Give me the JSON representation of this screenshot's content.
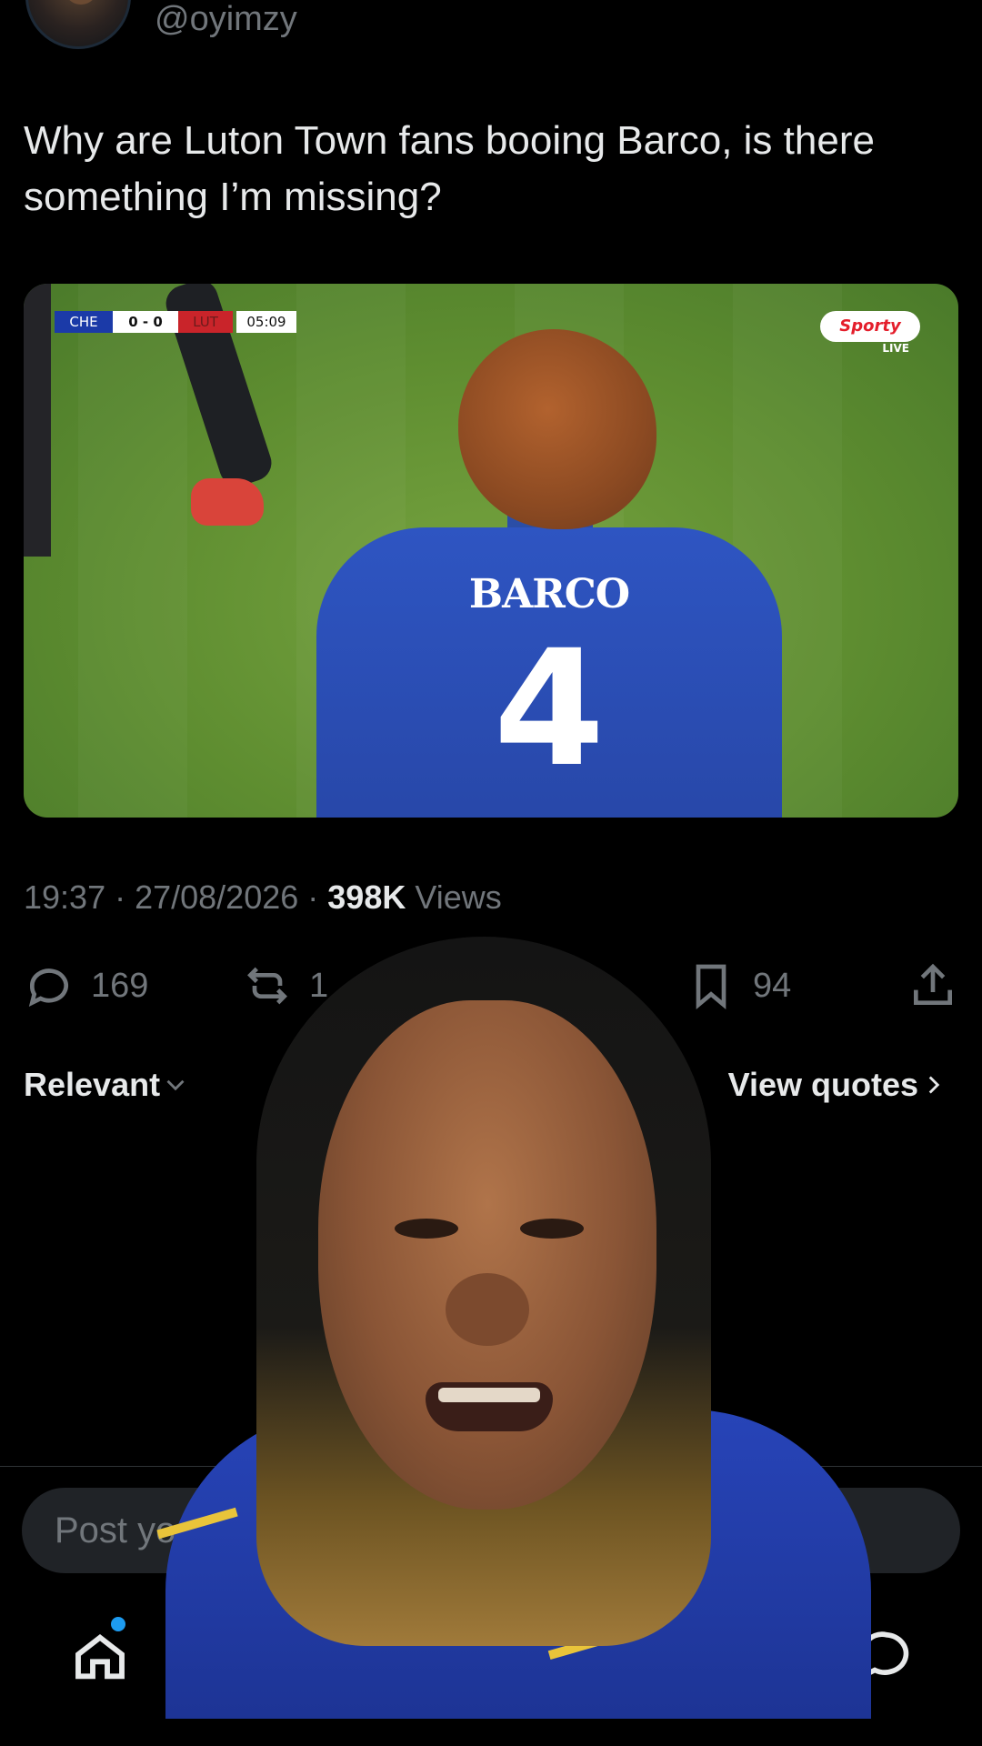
{
  "tweet": {
    "handle": "@oyimzy",
    "text": "Why are Luton Town fans booing Barco, is there something I’m missing?",
    "time": "19:37",
    "date": "27/08/2026",
    "views_count": "398K",
    "views_label": "Views"
  },
  "media": {
    "scoreboard": {
      "home": "CHE",
      "score": "0 - 0",
      "away": "LUT",
      "clock": "05:09"
    },
    "broadcaster": "Sporty",
    "broadcaster_sub": "LIVE",
    "shirt_name": "BARCO",
    "shirt_number": "4"
  },
  "actions": {
    "replies": "169",
    "reposts": "1",
    "bookmarks": "94"
  },
  "sort": {
    "label": "Relevant"
  },
  "quotes": {
    "label": "View quotes"
  },
  "reply": {
    "placeholder": "Post yo"
  },
  "colors": {
    "background": "#000000",
    "text": "#e7e9ea",
    "muted": "#71767b",
    "accent": "#1d9bf0"
  }
}
